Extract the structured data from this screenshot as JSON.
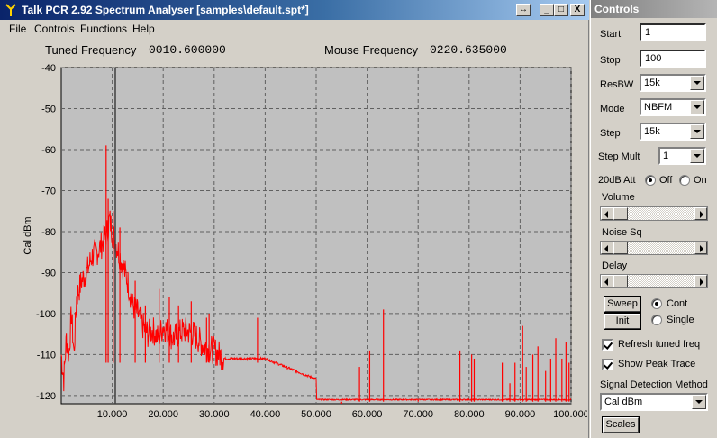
{
  "window": {
    "title": "Talk PCR 2.92 Spectrum Analyser [samples\\default.spt*]",
    "buttons": {
      "restore": "↔",
      "minimize": "_",
      "maximize": "□",
      "close": "X"
    }
  },
  "menu": [
    "File",
    "Controls",
    "Functions",
    "Help"
  ],
  "readouts": {
    "tuned_label": "Tuned Frequency",
    "tuned_value": "0010.600000",
    "mouse_label": "Mouse Frequency",
    "mouse_value": "0220.635000"
  },
  "chart_data": {
    "type": "line",
    "xlabel": "",
    "ylabel": "Cal dBm",
    "xlim": [
      0,
      100
    ],
    "ylim": [
      -122,
      -40
    ],
    "x_ticks": [
      10,
      20,
      30,
      40,
      50,
      60,
      70,
      80,
      90,
      100
    ],
    "x_tick_labels": [
      "10.000",
      "20.000",
      "30.000",
      "40.000",
      "50.000",
      "60.000",
      "70.000",
      "80.000",
      "90.000",
      "100.000"
    ],
    "y_ticks": [
      -40,
      -50,
      -60,
      -70,
      -80,
      -90,
      -100,
      -110,
      -120
    ],
    "y_tick_labels": [
      "-40",
      "-50",
      "-60",
      "-70",
      "-80",
      "-90",
      "-100",
      "-110",
      "-120"
    ],
    "grid": true,
    "tuned_marker_x": 10.6,
    "colors": {
      "trace": "#ff0000",
      "plot_bg": "#c0c0c0",
      "grid": "#606060",
      "marker": "#404040"
    },
    "series": [
      {
        "x": [
          0,
          0.5,
          1,
          1.5,
          2,
          2.5,
          3,
          4,
          5,
          6,
          7,
          8,
          9,
          9.5,
          10,
          10.5,
          11,
          12,
          13,
          14,
          15,
          16,
          17,
          18,
          19,
          20,
          22,
          24,
          26,
          28,
          30,
          32,
          34,
          36,
          38,
          40,
          42,
          44,
          46,
          48,
          50,
          50.1,
          55,
          60,
          65,
          70,
          75,
          80,
          85,
          90,
          95,
          100
        ],
        "values": [
          -110,
          -116,
          -106,
          -110,
          -100,
          -110,
          -96,
          -92,
          -90,
          -86,
          -85,
          -83,
          -80,
          -77,
          -80,
          -82,
          -84,
          -88,
          -92,
          -98,
          -100,
          -103,
          -105,
          -104,
          -106,
          -103,
          -106,
          -104,
          -105,
          -108,
          -109,
          -111,
          -111,
          -111,
          -111,
          -111,
          -112,
          -113,
          -114,
          -115,
          -116,
          -121,
          -121,
          -121,
          -121,
          -121,
          -121,
          -121,
          -121,
          -121,
          -121,
          -121
        ]
      }
    ],
    "peaks": [
      {
        "x": 9.2,
        "y": -72
      },
      {
        "x": 8.8,
        "y": -59
      },
      {
        "x": 10.2,
        "y": -75
      },
      {
        "x": 11.5,
        "y": -79
      },
      {
        "x": 14.5,
        "y": -92
      },
      {
        "x": 16.5,
        "y": -98
      },
      {
        "x": 19.2,
        "y": -94
      },
      {
        "x": 21.2,
        "y": -96
      },
      {
        "x": 23.0,
        "y": -98
      },
      {
        "x": 25.5,
        "y": -97
      },
      {
        "x": 28.5,
        "y": -101
      },
      {
        "x": 29.0,
        "y": -100
      },
      {
        "x": 38.5,
        "y": -101
      },
      {
        "x": 55.0,
        "y": -122
      },
      {
        "x": 58.5,
        "y": -113
      },
      {
        "x": 60.5,
        "y": -109
      },
      {
        "x": 63.2,
        "y": -99
      },
      {
        "x": 70.0,
        "y": -121
      },
      {
        "x": 78.2,
        "y": -109
      },
      {
        "x": 80.5,
        "y": -110
      },
      {
        "x": 81.0,
        "y": -111
      },
      {
        "x": 86.5,
        "y": -112
      },
      {
        "x": 88.0,
        "y": -117
      },
      {
        "x": 89.0,
        "y": -112
      },
      {
        "x": 90.5,
        "y": -103
      },
      {
        "x": 91.2,
        "y": -113
      },
      {
        "x": 92.5,
        "y": -110
      },
      {
        "x": 93.5,
        "y": -108
      },
      {
        "x": 95.0,
        "y": -114
      },
      {
        "x": 96.0,
        "y": -111
      },
      {
        "x": 97.0,
        "y": -106
      },
      {
        "x": 98.2,
        "y": -111
      },
      {
        "x": 99.0,
        "y": -107
      },
      {
        "x": 99.6,
        "y": -112
      }
    ]
  },
  "controls": {
    "title": "Controls",
    "start_label": "Start",
    "start_value": "1",
    "stop_label": "Stop",
    "stop_value": "100",
    "resbw_label": "ResBW",
    "resbw_value": "15k",
    "mode_label": "Mode",
    "mode_value": "NBFM",
    "step_label": "Step",
    "step_value": "15k",
    "stepmult_label": "Step Mult",
    "stepmult_value": "1",
    "att_label": "20dB Att",
    "att_off": "Off",
    "att_on": "On",
    "att_selected": "Off",
    "volume_label": "Volume",
    "noise_label": "Noise Sq",
    "delay_label": "Delay",
    "sweep_button": "Sweep",
    "init_button": "Init",
    "cont_label": "Cont",
    "single_label": "Single",
    "refresh_label": "Refresh tuned freq",
    "peak_label": "Show Peak Trace",
    "signal_label": "Signal Detection Method",
    "signal_value": "Cal dBm",
    "scales_button": "Scales"
  }
}
